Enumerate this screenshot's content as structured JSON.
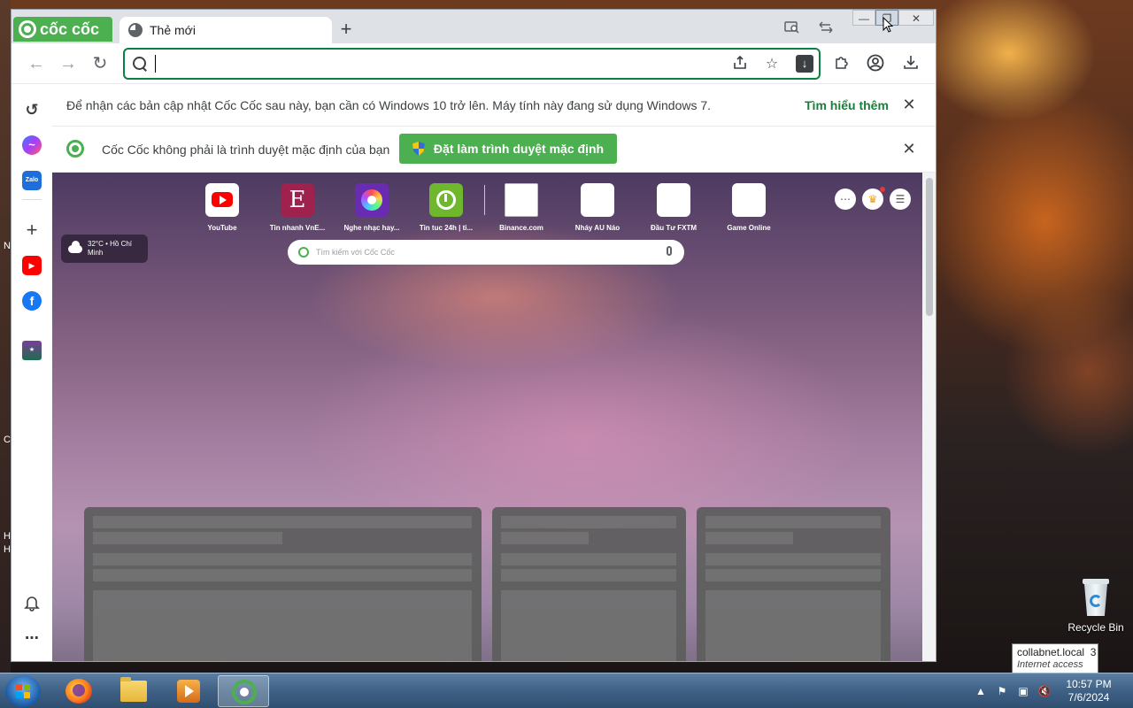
{
  "desktop": {
    "recycle_bin_label": "Recycle Bin",
    "left_edge_letters": [
      "N",
      "C",
      "H",
      "H"
    ]
  },
  "tooltip": {
    "network": "collabnet.local",
    "count": "3",
    "status": "Internet access"
  },
  "browser": {
    "brand": "cốc cốc",
    "tab_title": "Thẻ mới",
    "new_tab_symbol": "+",
    "omnibox_value": "",
    "accent_color": "#4caf50"
  },
  "infobar_update": {
    "message": "Để nhận các bản cập nhật Cốc Cốc sau này, bạn cần có Windows 10 trở lên. Máy tính này đang sử dụng Windows 7.",
    "link": "Tìm hiểu thêm",
    "close_symbol": "✕"
  },
  "infobar_default": {
    "message": "Cốc Cốc không phải là trình duyệt mặc định của bạn",
    "button": "Đặt làm trình duyệt mặc định",
    "close_symbol": "✕"
  },
  "ntp": {
    "shortcuts": [
      {
        "label": "YouTube",
        "icon": "youtube-icon"
      },
      {
        "label": "Tin nhanh VnE...",
        "icon": "vnexpress-icon"
      },
      {
        "label": "Nghe nhạc hay...",
        "icon": "music-icon"
      },
      {
        "label": "Tin tuc 24h | ti...",
        "icon": "news-24h-icon"
      },
      {
        "label": "Binance.com",
        "icon": "binance-icon"
      },
      {
        "label": "Nháy AU Náo",
        "icon": "au-icon"
      },
      {
        "label": "Đầu Tư FXTM",
        "icon": "fxtm-icon"
      },
      {
        "label": "Game Online",
        "icon": "game-icon"
      }
    ],
    "weather": {
      "line1": "32°C • Hồ Chí",
      "line2": "Minh"
    },
    "search_placeholder": "Tìm kiếm với Cốc Cốc"
  },
  "taskbar": {
    "time": "10:57 PM",
    "date": "7/6/2024"
  }
}
